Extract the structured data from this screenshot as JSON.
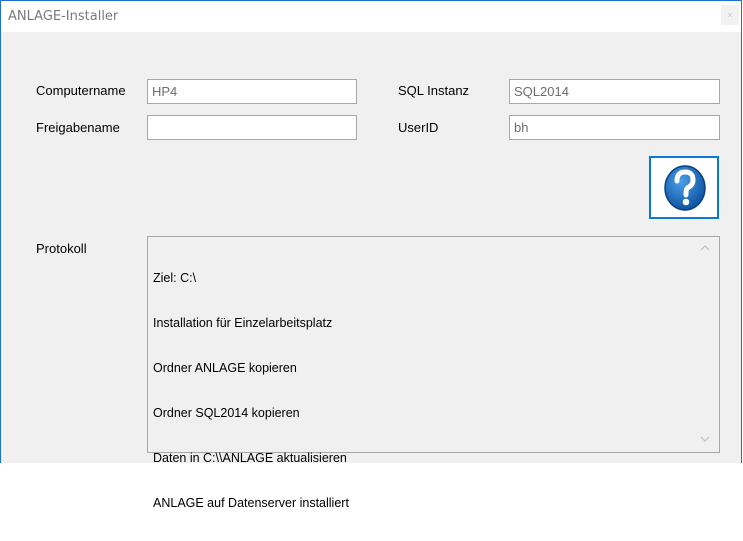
{
  "window": {
    "title": "ANLAGE-Installer",
    "close_glyph": "×"
  },
  "form": {
    "computername_label": "Computername",
    "computername_value": "HP4",
    "freigabename_label": "Freigabename",
    "freigabename_value": "",
    "sql_instanz_label": "SQL Instanz",
    "sql_instanz_value": "SQL2014",
    "userid_label": "UserID",
    "userid_value": "bh"
  },
  "help_button": {
    "icon": "question-icon",
    "accent": "#1b6fc9",
    "border": "#0a78d7"
  },
  "protokoll": {
    "label": "Protokoll",
    "lines": [
      "Ziel: C:\\",
      "Installation für Einzelarbeitsplatz",
      "Ordner ANLAGE kopieren",
      "Ordner SQL2014 kopieren",
      "Daten in C:\\\\ANLAGE aktualisieren",
      "ANLAGE auf Datenserver installiert"
    ]
  },
  "colors": {
    "window_border": "#1e6fd6",
    "background": "#f0f0f0"
  }
}
